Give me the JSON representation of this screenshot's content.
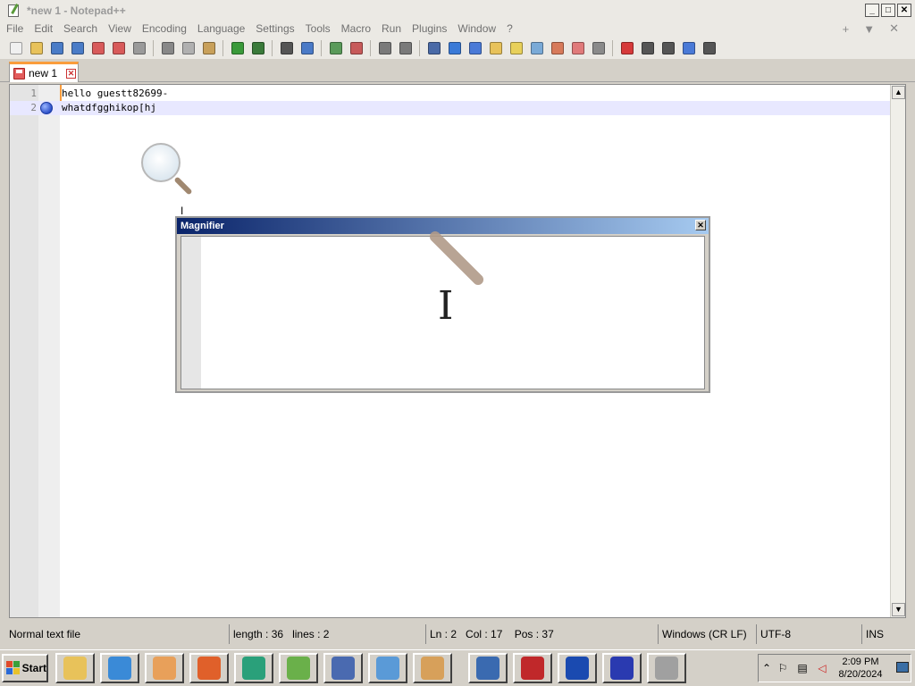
{
  "window": {
    "title": "*new 1 - Notepad++",
    "controls": {
      "minimize": "_",
      "maximize": "□",
      "close": "✕"
    }
  },
  "menu": {
    "items": [
      "File",
      "Edit",
      "Search",
      "View",
      "Encoding",
      "Language",
      "Settings",
      "Tools",
      "Macro",
      "Run",
      "Plugins",
      "Window",
      "?"
    ],
    "right": {
      "plus": "+",
      "dropdown": "▼",
      "close": "✕"
    }
  },
  "toolbar": {
    "buttons": [
      {
        "name": "new-file-icon",
        "color": "#f0f0f0"
      },
      {
        "name": "open-file-icon",
        "color": "#e8c25a"
      },
      {
        "name": "save-icon",
        "color": "#4a7cc7"
      },
      {
        "name": "save-all-icon",
        "color": "#4a7cc7"
      },
      {
        "name": "close-icon",
        "color": "#d85a5a"
      },
      {
        "name": "close-all-icon",
        "color": "#d85a5a"
      },
      {
        "name": "print-icon",
        "color": "#9a9a9a"
      },
      {
        "name": "cut-icon",
        "color": "#888888"
      },
      {
        "name": "copy-icon",
        "color": "#b0b0b0"
      },
      {
        "name": "paste-icon",
        "color": "#c8a05a"
      },
      {
        "name": "undo-icon",
        "color": "#3a9a3a"
      },
      {
        "name": "redo-icon",
        "color": "#3a7a3a"
      },
      {
        "name": "find-icon",
        "color": "#555555"
      },
      {
        "name": "replace-icon",
        "color": "#4a7ac7"
      },
      {
        "name": "zoom-in-icon",
        "color": "#5a9a5a"
      },
      {
        "name": "zoom-out-icon",
        "color": "#c75a5a"
      },
      {
        "name": "sync-vertical-icon",
        "color": "#7a7a7a"
      },
      {
        "name": "sync-horizontal-icon",
        "color": "#7a7a7a"
      },
      {
        "name": "word-wrap-icon",
        "color": "#4a6aa7"
      },
      {
        "name": "show-all-chars-icon",
        "color": "#3a7ad7"
      },
      {
        "name": "indent-guide-icon",
        "color": "#4a7ad7"
      },
      {
        "name": "udl-icon",
        "color": "#e8c25a"
      },
      {
        "name": "function-list-icon",
        "color": "#e8d05a"
      },
      {
        "name": "doc-map-icon",
        "color": "#7aaad7"
      },
      {
        "name": "folder-workspace-icon",
        "color": "#d77a5a"
      },
      {
        "name": "monitor-icon",
        "color": "#e07a7a"
      },
      {
        "name": "doc-switcher-icon",
        "color": "#8a8a8a"
      },
      {
        "name": "record-macro-icon",
        "color": "#d63a3a"
      },
      {
        "name": "stop-record-icon",
        "color": "#555555"
      },
      {
        "name": "playback-icon",
        "color": "#555555"
      },
      {
        "name": "run-multiple-icon",
        "color": "#4a7ad7"
      },
      {
        "name": "save-macro-icon",
        "color": "#555555"
      }
    ],
    "separators_after": [
      6,
      9,
      11,
      13,
      15,
      17,
      26
    ]
  },
  "tab": {
    "label": "new 1",
    "close": "✕"
  },
  "editor": {
    "lines": [
      {
        "num": "1",
        "text": "hello guestt82699-"
      },
      {
        "num": "2",
        "text": "whatdfgghikop[hj"
      }
    ],
    "current_line": 2,
    "scroll_up": "▲",
    "scroll_down": "▼"
  },
  "magnifier": {
    "title": "Magnifier",
    "close": "✕",
    "ibeam": "I"
  },
  "statusbar": {
    "filetype": "Normal text file",
    "length": "length : 36",
    "lines": "lines : 2",
    "ln": "Ln : 2",
    "col": "Col : 17",
    "pos": "Pos : 37",
    "eol": "Windows (CR LF)",
    "encoding": "UTF-8",
    "mode": "INS"
  },
  "taskbar": {
    "start_label": "Start",
    "apps": [
      {
        "name": "explorer-app",
        "color": "#e8c25a"
      },
      {
        "name": "internet-explorer-app",
        "color": "#3a8ad7"
      },
      {
        "name": "media-player-app",
        "color": "#e8a05a"
      },
      {
        "name": "firefox-app",
        "color": "#e0602a"
      },
      {
        "name": "chat-app",
        "color": "#2aa07a"
      },
      {
        "name": "notepad-plus-plus-app",
        "color": "#6ab04a"
      },
      {
        "name": "calculator-app",
        "color": "#4a6ab0"
      },
      {
        "name": "mail-app",
        "color": "#5a9ad7"
      },
      {
        "name": "paint-app",
        "color": "#d7a05a"
      },
      {
        "name": "remote-desktop-app",
        "color": "#3a6ab0"
      },
      {
        "name": "acrobat-app",
        "color": "#c0282a"
      },
      {
        "name": "network-app",
        "color": "#1a4ab0"
      },
      {
        "name": "infinity-app",
        "color": "#2a3ab0"
      },
      {
        "name": "printer-app",
        "color": "#a0a0a0"
      }
    ],
    "tray": {
      "time": "2:09 PM",
      "date": "8/20/2024"
    }
  }
}
